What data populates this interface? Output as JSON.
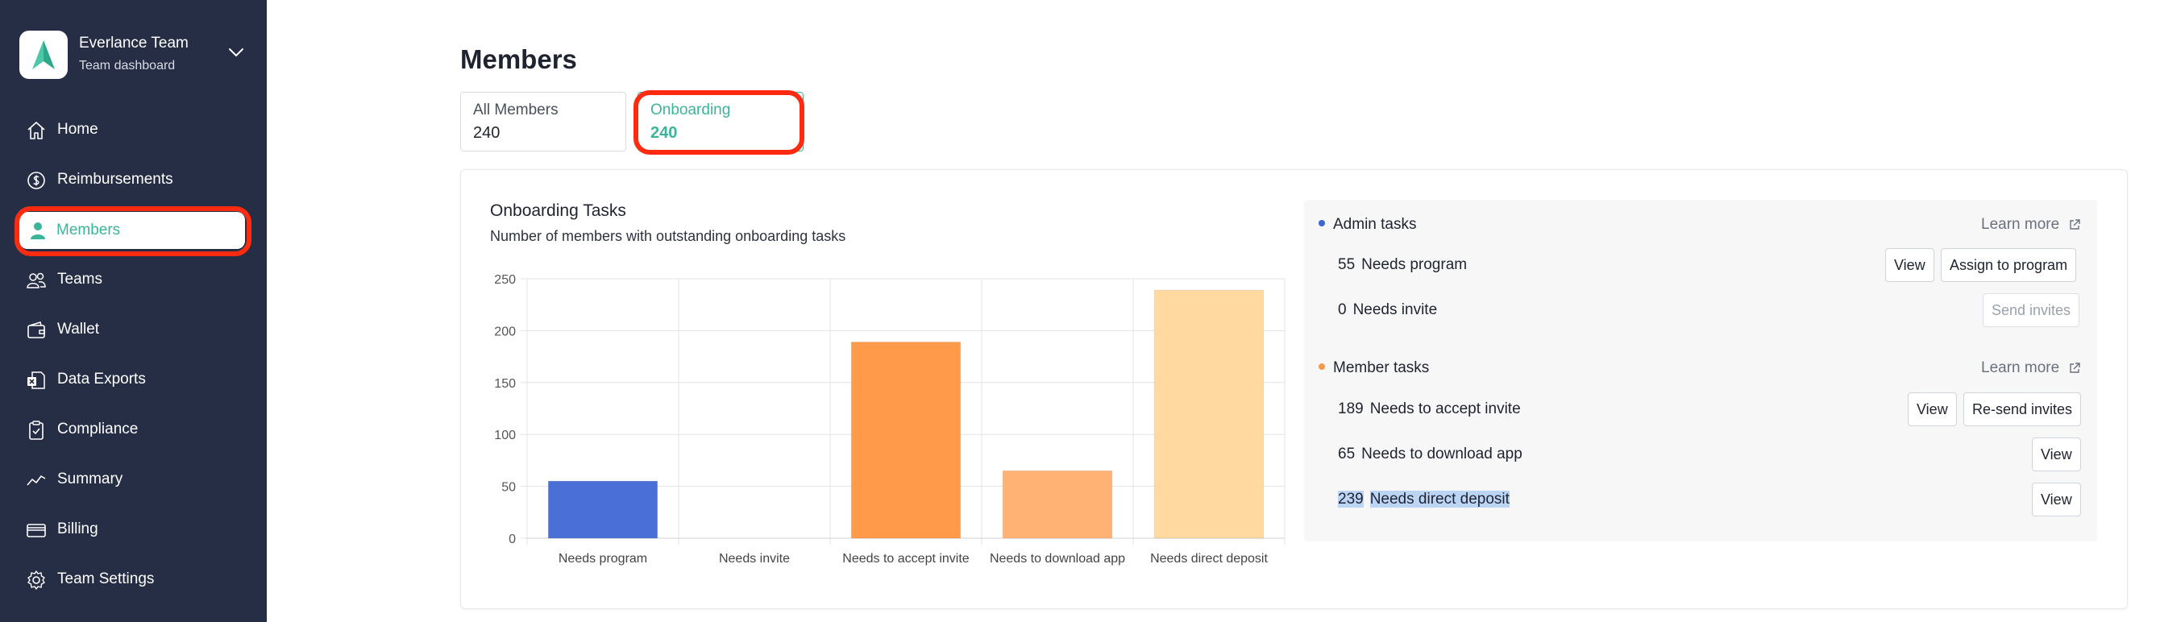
{
  "team": {
    "name": "Everlance Team",
    "subtitle": "Team dashboard"
  },
  "sidebar": {
    "items": [
      {
        "label": "Home",
        "icon": "home-icon"
      },
      {
        "label": "Reimbursements",
        "icon": "dollar-icon"
      },
      {
        "label": "Members",
        "icon": "person-icon",
        "active": true
      },
      {
        "label": "Teams",
        "icon": "people-icon"
      },
      {
        "label": "Wallet",
        "icon": "wallet-icon"
      },
      {
        "label": "Data Exports",
        "icon": "spreadsheet-icon"
      },
      {
        "label": "Compliance",
        "icon": "clipboard-check-icon"
      },
      {
        "label": "Summary",
        "icon": "trend-line-icon"
      },
      {
        "label": "Billing",
        "icon": "credit-card-icon"
      },
      {
        "label": "Team Settings",
        "icon": "gear-icon"
      }
    ]
  },
  "page": {
    "title": "Members"
  },
  "tabs": [
    {
      "label": "All Members",
      "count": "240"
    },
    {
      "label": "Onboarding",
      "count": "240",
      "active": true
    }
  ],
  "chart_data": {
    "type": "bar",
    "title": "Onboarding Tasks",
    "subtitle": "Number of members with outstanding onboarding tasks",
    "categories": [
      "Needs program",
      "Needs invite",
      "Needs to accept invite",
      "Needs to download app",
      "Needs direct deposit"
    ],
    "values": [
      55,
      0,
      189,
      65,
      239
    ],
    "colors": [
      "#4a6fd6",
      "#e8e8e8",
      "#ff9a4a",
      "#ffb273",
      "#ffd9a0"
    ],
    "ylim": [
      0,
      250
    ],
    "yticks": [
      0,
      50,
      100,
      150,
      200,
      250
    ],
    "grid": true,
    "xlabel": "",
    "ylabel": ""
  },
  "tasks": {
    "learn_more": "Learn more",
    "admin": {
      "title": "Admin tasks",
      "color": "#3f65d4",
      "rows": [
        {
          "count": "55",
          "label": "Needs program",
          "buttons": [
            "View",
            "Assign to program"
          ]
        },
        {
          "count": "0",
          "label": "Needs invite",
          "buttons": [
            "Send invites"
          ]
        }
      ]
    },
    "member": {
      "title": "Member tasks",
      "color": "#f59a4a",
      "rows": [
        {
          "count": "189",
          "label": "Needs to accept invite",
          "buttons": [
            "View",
            "Re-send invites"
          ]
        },
        {
          "count": "65",
          "label": "Needs to download app",
          "buttons": [
            "View"
          ]
        },
        {
          "count": "239",
          "label": "Needs direct deposit",
          "buttons": [
            "View"
          ]
        }
      ]
    }
  },
  "colors": {
    "sidebar_bg": "#262e45",
    "accent": "#3cb39b",
    "highlight": "#ff2b10"
  }
}
